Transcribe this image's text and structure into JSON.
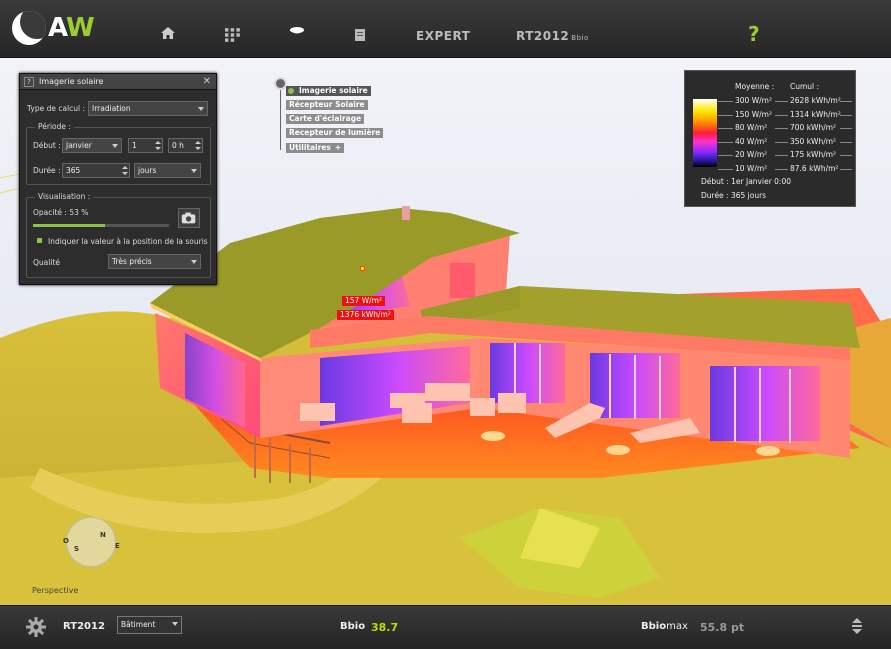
{
  "app": {
    "logo": "AW"
  },
  "nav": {
    "home_icon": "home-icon",
    "grid_icon": "grid-icon",
    "sun_icon": "sun-icon",
    "doc_icon": "document-icon",
    "expert": "EXPERT",
    "rt": "RT2012",
    "rt_sub": "Bbio",
    "help": "?"
  },
  "panel": {
    "help": "?",
    "title": "Imagerie solaire",
    "close": "✕",
    "type_label": "Type de calcul :",
    "type_value": "Irradiation",
    "periode_title": "Période :",
    "debut_label": "Début :",
    "debut_month": "Janvier",
    "debut_day": "1",
    "debut_hour": "0 h",
    "duree_label": "Durée :",
    "duree_value": "365",
    "duree_unit": "jours",
    "visu_title": "Visualisation :",
    "opacite_label": "Opacité : 53 %",
    "opacite_value": 0.53,
    "indicate_label": "Indiquer la valeur à la position de la souris",
    "qualite_label": "Qualité",
    "qualite_value": "Très précis"
  },
  "tree": {
    "items": [
      "Imagerie solaire",
      "Récepteur Solaire",
      "Carte d'éclairage",
      "Recepteur de lumière",
      "Utilitaires"
    ]
  },
  "legend": {
    "head_avg": "Moyenne :",
    "head_cum": "Cumul :",
    "rows": [
      {
        "avg": "300 W/m²",
        "cum": "2628 kWh/m²"
      },
      {
        "avg": "150 W/m²",
        "cum": "1314 kWh/m²"
      },
      {
        "avg": "80 W/m²",
        "cum": "700 kWh/m²"
      },
      {
        "avg": "40 W/m²",
        "cum": "350 kWh/m²"
      },
      {
        "avg": "20 W/m²",
        "cum": "175 kWh/m²"
      },
      {
        "avg": "10 W/m²",
        "cum": "87.6 kWh/m²"
      }
    ],
    "debut": "Début : 1er Janvier 0:00",
    "duree": "Durée : 365 jours",
    "colors": [
      "#ffffff",
      "#ffe600",
      "#ff8a00",
      "#ff1a3a",
      "#ff33cc",
      "#8a2aff",
      "#2a1aa8",
      "#000000"
    ]
  },
  "probe": {
    "wm2": "157 W/m²",
    "kwh": "1376 kWh/m²"
  },
  "compass": {
    "o": "O",
    "s": "S",
    "n": "N",
    "e": "E"
  },
  "view": "Perspective",
  "bottom": {
    "rt": "RT2012",
    "batiment": "Bâtiment",
    "bbio_label": "Bbio",
    "bbio_value": "38.7",
    "bbiomax_a": "Bbio",
    "bbiomax_b": "max",
    "bbiomax_value": "55.8 pt"
  }
}
